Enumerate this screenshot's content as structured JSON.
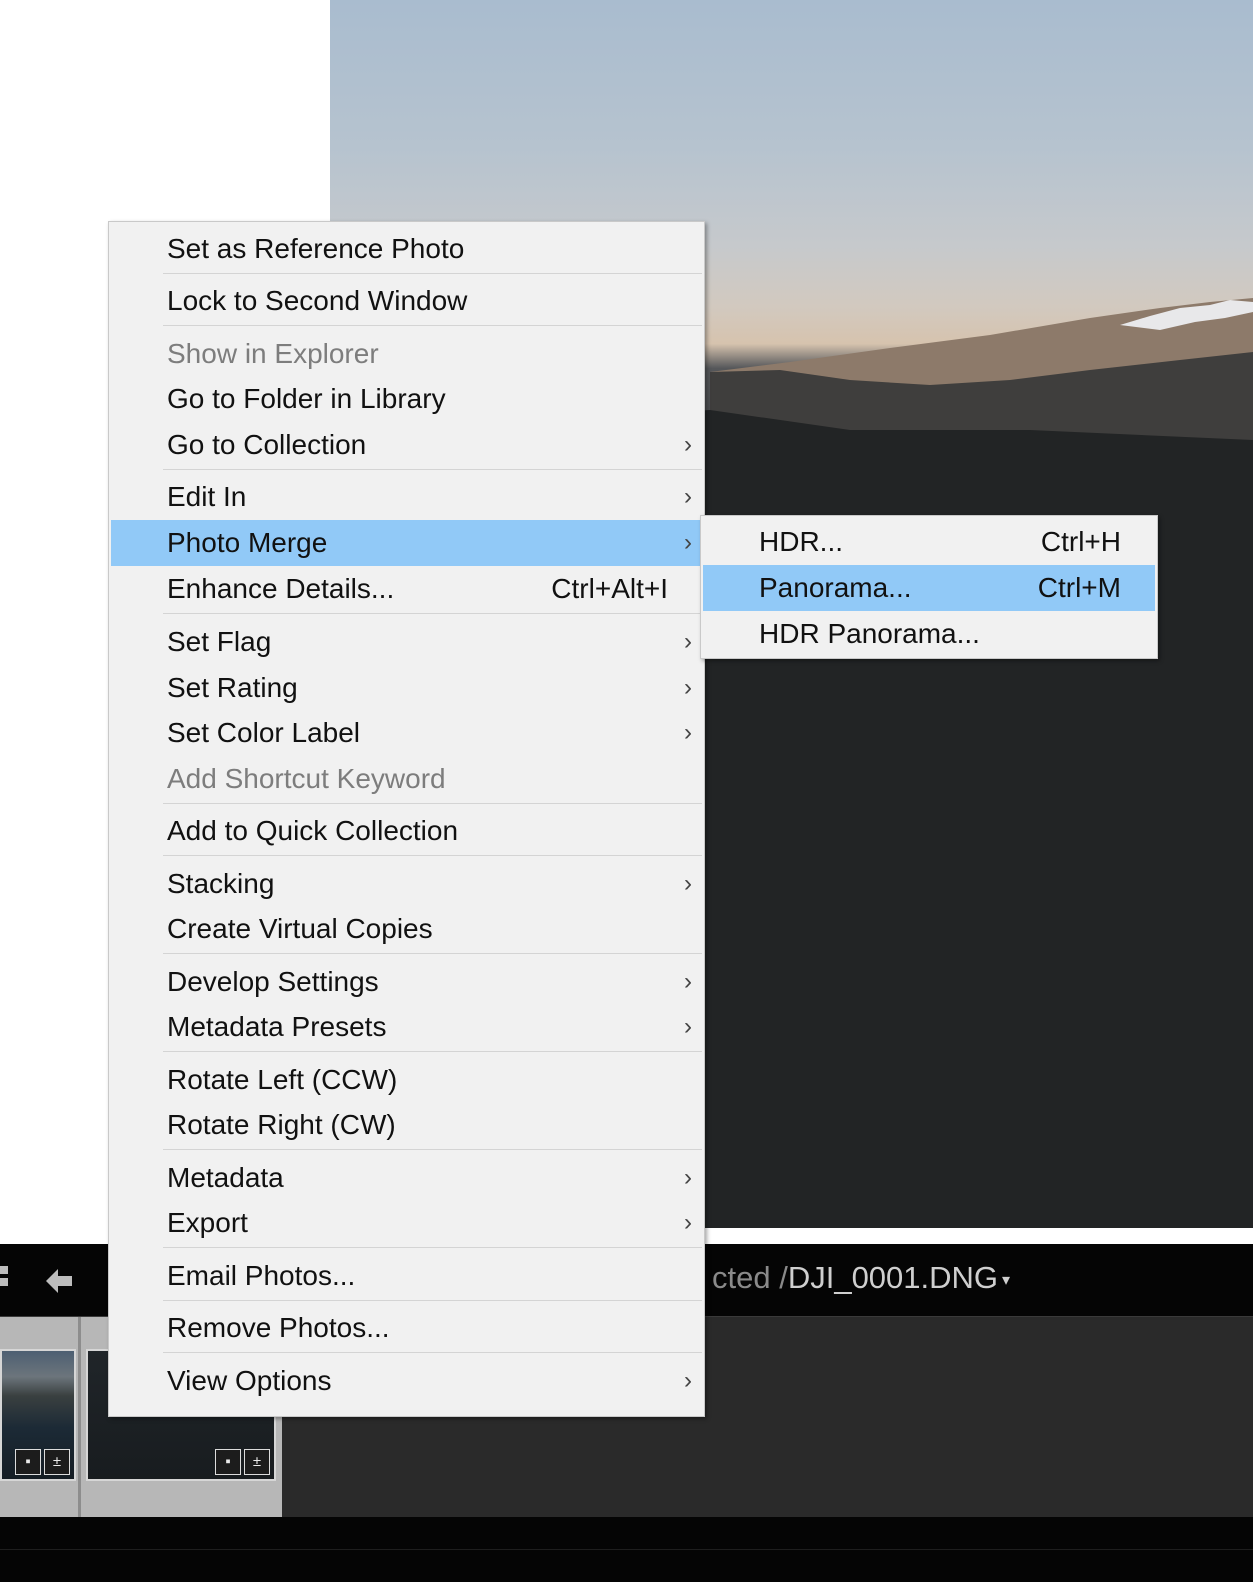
{
  "menu": {
    "items": [
      {
        "label": "Set as Reference Photo"
      },
      {
        "label": "Lock to Second Window"
      },
      {
        "label": "Show in Explorer"
      },
      {
        "label": "Go to Folder in Library"
      },
      {
        "label": "Go to Collection"
      },
      {
        "label": "Edit In"
      },
      {
        "label": "Photo Merge"
      },
      {
        "label": "Enhance Details...",
        "shortcut": "Ctrl+Alt+I"
      },
      {
        "label": "Set Flag"
      },
      {
        "label": "Set Rating"
      },
      {
        "label": "Set Color Label"
      },
      {
        "label": "Add Shortcut Keyword"
      },
      {
        "label": "Add to Quick Collection"
      },
      {
        "label": "Stacking"
      },
      {
        "label": "Create Virtual Copies"
      },
      {
        "label": "Develop Settings"
      },
      {
        "label": "Metadata Presets"
      },
      {
        "label": "Rotate Left (CCW)"
      },
      {
        "label": "Rotate Right (CW)"
      },
      {
        "label": "Metadata"
      },
      {
        "label": "Export"
      },
      {
        "label": "Email Photos..."
      },
      {
        "label": "Remove Photos..."
      },
      {
        "label": "View Options"
      }
    ]
  },
  "submenu": {
    "items": [
      {
        "label": "HDR...",
        "shortcut": "Ctrl+H"
      },
      {
        "label": "Panorama...",
        "shortcut": "Ctrl+M"
      },
      {
        "label": "HDR Panorama..."
      }
    ]
  },
  "toolbar": {
    "path_prefix": "cted /",
    "filename": "DJI_0001.DNG",
    "caret": "▾"
  },
  "filmstrip": {
    "badge_flag": "▪",
    "badge_adjust": "±"
  },
  "icons": {
    "chevron": "›",
    "back_arrow": "back-arrow-icon",
    "grid": "grid-view-icon"
  },
  "colors": {
    "highlight": "#91c9f7",
    "menu_bg": "#f1f1f1",
    "disabled_text": "#7d7d7d"
  }
}
